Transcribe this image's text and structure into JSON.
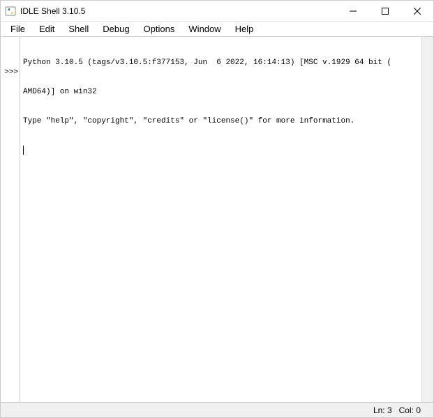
{
  "window": {
    "title": "IDLE Shell 3.10.5"
  },
  "menubar": {
    "items": [
      "File",
      "Edit",
      "Shell",
      "Debug",
      "Options",
      "Window",
      "Help"
    ]
  },
  "shell": {
    "banner_line1": "Python 3.10.5 (tags/v3.10.5:f377153, Jun  6 2022, 16:14:13) [MSC v.1929 64 bit (",
    "banner_line2": "AMD64)] on win32",
    "banner_line3": "Type \"help\", \"copyright\", \"credits\" or \"license()\" for more information.",
    "prompt": ">>>"
  },
  "statusbar": {
    "line": "Ln: 3",
    "col": "Col: 0"
  }
}
